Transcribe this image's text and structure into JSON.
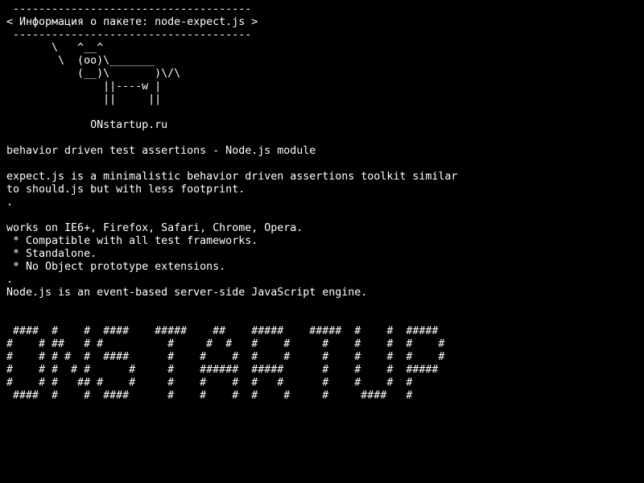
{
  "terminal": {
    "lines": [
      " -------------------------------------",
      "< Информация о пакете: node-expect.js >",
      " -------------------------------------",
      "       \\   ^__^",
      "        \\  (oo)\\_______",
      "           (__)\\       )\\/\\",
      "               ||----w |",
      "               ||     ||",
      "",
      "             ONstartup.ru",
      "",
      "behavior driven test assertions - Node.js module",
      "",
      "expect.js is a minimalistic behavior driven assertions toolkit similar",
      "to should.js but with less footprint.",
      ".",
      "",
      "works on IE6+, Firefox, Safari, Chrome, Opera.",
      " * Compatible with all test frameworks.",
      " * Standalone.",
      " * No Object prototype extensions.",
      ".",
      "Node.js is an event-based server-side JavaScript engine.",
      "",
      "",
      " ####  #    #  ####    #####    ##    #####    #####  #    #  #####",
      "#    # ##   # #          #     #  #   #    #     #    #    #  #    #",
      "#    # # #  #  ####      #    #    #  #    #     #    #    #  #    #",
      "#    # #  # #      #     #    ######  #####      #    #    #  #####",
      "#    # #   ## #    #     #    #    #  #   #      #    #    #  #",
      " ####  #    #  ####      #    #    #  #    #     #     ####   #"
    ]
  }
}
